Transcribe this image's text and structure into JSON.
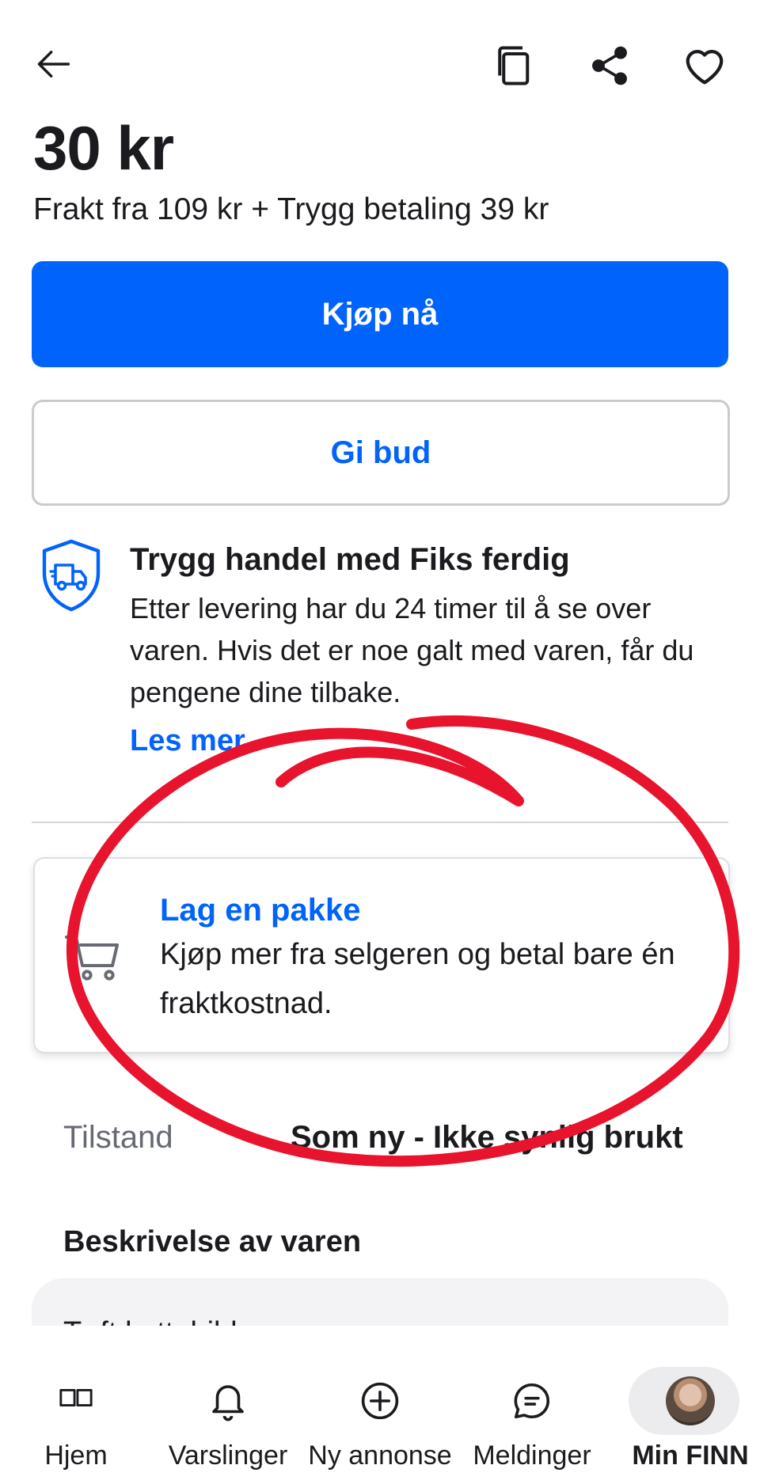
{
  "topbar": {
    "back_icon": "arrow-left-icon",
    "copy_icon": "copy-icon",
    "share_icon": "share-icon",
    "favorite_icon": "heart-icon"
  },
  "listing": {
    "price": "30 kr",
    "shipping": "Frakt fra 109 kr + Trygg betaling 39 kr"
  },
  "actions": {
    "buy_now": "Kjøp nå",
    "make_offer": "Gi bud"
  },
  "safe_trade": {
    "icon": "shield-truck-icon",
    "title": "Trygg handel med Fiks ferdig",
    "body": "Etter levering har du 24 timer til å se over varen. Hvis det er noe galt med varen, får du pengene dine tilbake.",
    "link": "Les mer"
  },
  "bundle": {
    "icon": "cart-icon",
    "title": "Lag en pakke",
    "body": "Kjøp mer fra selgeren og betal bare én fraktkostnad."
  },
  "condition": {
    "label": "Tilstand",
    "value": "Som ny - Ikke synlig brukt"
  },
  "description": {
    "heading": "Beskrivelse av varen",
    "text": "Tøft kattebilde"
  },
  "bottom_nav": [
    {
      "label": "Hjem",
      "icon": "book-icon"
    },
    {
      "label": "Varslinger",
      "icon": "bell-icon"
    },
    {
      "label": "Ny annonse",
      "icon": "plus-circle-icon"
    },
    {
      "label": "Meldinger",
      "icon": "chat-icon"
    },
    {
      "label": "Min FINN",
      "icon": "avatar",
      "active": true
    }
  ],
  "colors": {
    "accent": "#0063fb",
    "annotation": "#e8132d"
  }
}
